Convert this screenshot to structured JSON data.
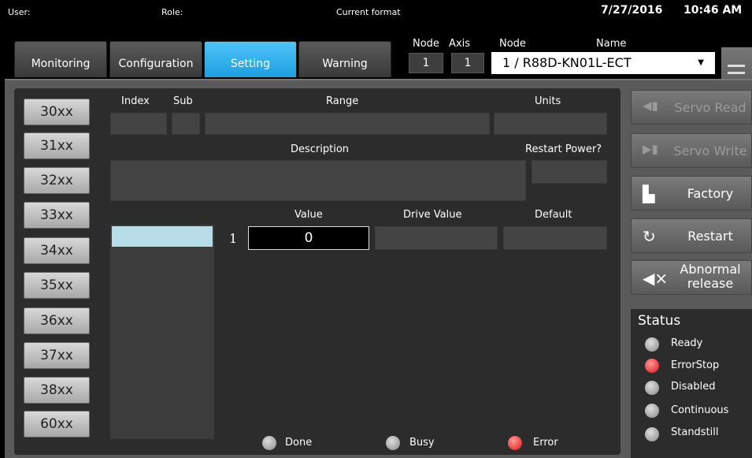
{
  "topbar": {
    "user_label": "User:",
    "role_label": "Role:",
    "format_label": "Current format",
    "date": "7/27/2016",
    "time": "10:46 AM"
  },
  "tabs": [
    {
      "label": "Monitoring"
    },
    {
      "label": "Configuration"
    },
    {
      "label": "Setting"
    },
    {
      "label": "Warning"
    }
  ],
  "node_axis": {
    "node_header": "Node",
    "axis_header": "Axis",
    "node_value": "1",
    "axis_value": "1",
    "node2_header": "Node",
    "name_header": "Name",
    "selected_name": "1 /  R88D-KN01L-ECT"
  },
  "groups": [
    "30xx",
    "31xx",
    "32xx",
    "33xx",
    "34xx",
    "35xx",
    "36xx",
    "37xx",
    "38xx",
    "60xx"
  ],
  "fields": {
    "index_label": "Index",
    "sub_label": "Sub",
    "range_label": "Range",
    "units_label": "Units",
    "description_label": "Description",
    "restart_label": "Restart Power?",
    "value_label": "Value",
    "drive_value_label": "Drive Value",
    "default_label": "Default",
    "row_number": "1",
    "value": "0"
  },
  "buttons": {
    "servo_read": "Servo Read",
    "servo_write": "Servo Write",
    "factory": "Factory",
    "restart": "Restart",
    "abnormal_release": "Abnormal release"
  },
  "indicators": {
    "done": "Done",
    "busy": "Busy",
    "error": "Error"
  },
  "status": {
    "title": "Status",
    "items": [
      {
        "label": "Ready",
        "state": "off"
      },
      {
        "label": "ErrorStop",
        "state": "red"
      },
      {
        "label": "Disabled",
        "state": "off"
      },
      {
        "label": "Continuous",
        "state": "off"
      },
      {
        "label": "Standstill",
        "state": "off"
      }
    ]
  },
  "colors": {
    "active_tab": "#1e9fe0",
    "error_led": "#e01010",
    "list_selection": "#b7dde9"
  }
}
